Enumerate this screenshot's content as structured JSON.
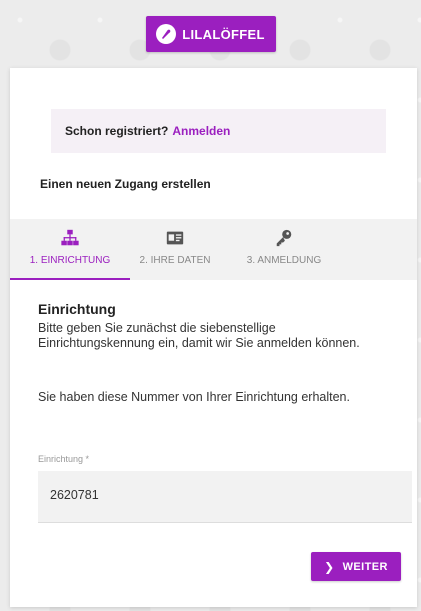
{
  "brand": {
    "name": "LILALÖFFEL",
    "color": "#9b1fbf"
  },
  "signin": {
    "prompt": "Schon registriert?",
    "link": "Anmelden"
  },
  "create_title": "Einen neuen Zugang erstellen",
  "steps": [
    {
      "label": "1. EINRICHTUNG",
      "icon": "sitemap-icon",
      "active": true
    },
    {
      "label": "2. IHRE DATEN",
      "icon": "id-card-icon",
      "active": false
    },
    {
      "label": "3. ANMELDUNG",
      "icon": "key-icon",
      "active": false
    }
  ],
  "section": {
    "title": "Einrichtung",
    "paragraph1": "Bitte geben Sie zunächst die siebenstellige Einrichtungskennung ein, damit wir Sie anmelden können.",
    "paragraph2": "Sie haben diese Nummer von Ihrer Einrichtung erhalten."
  },
  "field": {
    "label": "Einrichtung *",
    "value": "2620781"
  },
  "next_button": {
    "label": "WEITER"
  }
}
